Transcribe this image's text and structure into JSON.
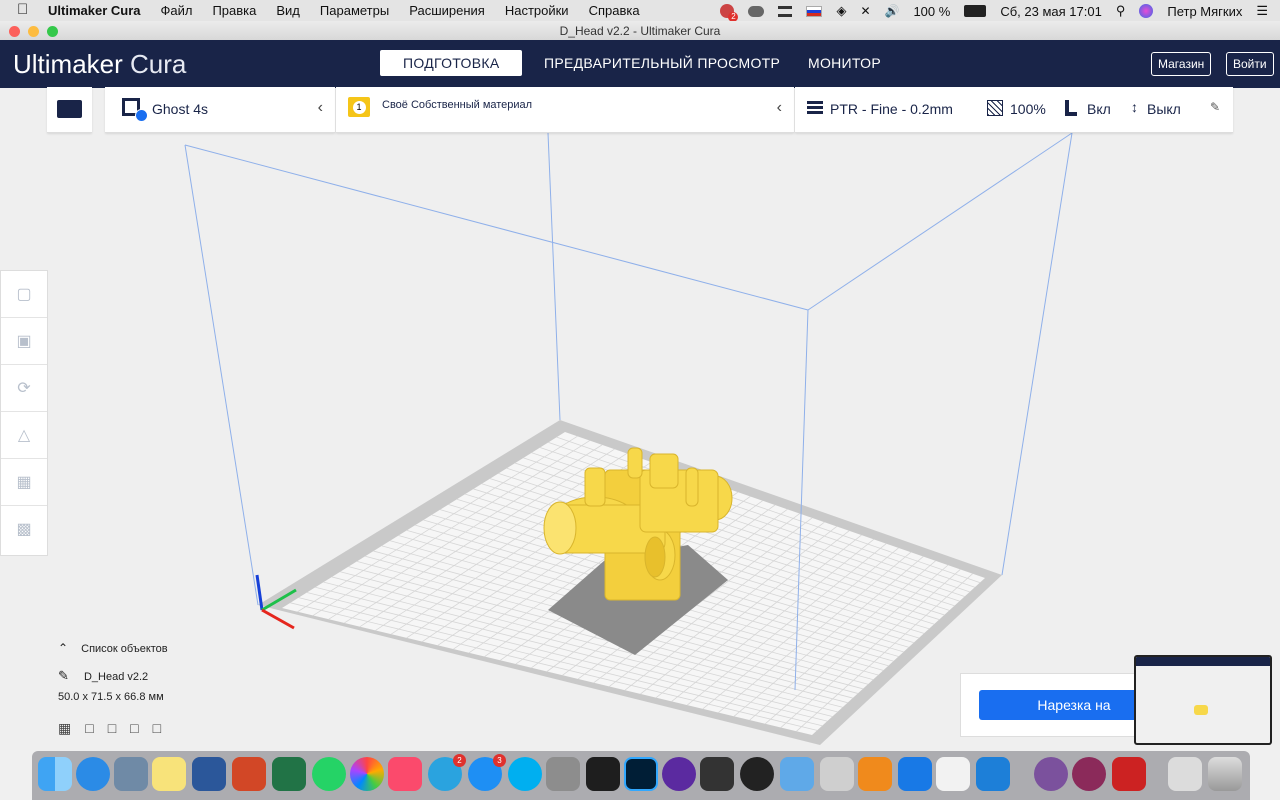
{
  "menubar": {
    "app_name": "Ultimaker Cura",
    "menus": [
      "Файл",
      "Правка",
      "Вид",
      "Параметры",
      "Расширения",
      "Настройки",
      "Справка"
    ],
    "battery": "100 %",
    "datetime": "Сб, 23 мая  17:01",
    "user": "Петр Мягких",
    "notification_count": "2"
  },
  "window": {
    "title": "D_Head v2.2  - Ultimaker Cura"
  },
  "header": {
    "logo_bold": "Ultimaker",
    "logo_light": "Cura",
    "tabs": [
      "ПОДГОТОВКА",
      "ПРЕДВАРИТЕЛЬНЫЙ ПРОСМОТР",
      "МОНИТОР"
    ],
    "active_tab": 0,
    "marketplace": "Магазин",
    "signin": "Войти"
  },
  "toolbar": {
    "printer": "Ghost 4s",
    "extruder_number": "1",
    "material": "Своё Собственный материал",
    "profile": "PTR - Fine - 0.2mm",
    "infill": "100%",
    "support": "Вкл",
    "adhesion": "Выкл"
  },
  "objects": {
    "list_title": "Список объектов",
    "name": "D_Head v2.2",
    "dimensions": "50.0 x 71.5 x 66.8 мм"
  },
  "slice": {
    "button": "Нарезка на"
  },
  "dock": {
    "badges": {
      "telegram": "2",
      "appstore": "3"
    }
  },
  "colors": {
    "header_bg": "#192448",
    "accent": "#196ef0",
    "model": "#f7d84a",
    "build_volume": "#6f9fe0"
  }
}
